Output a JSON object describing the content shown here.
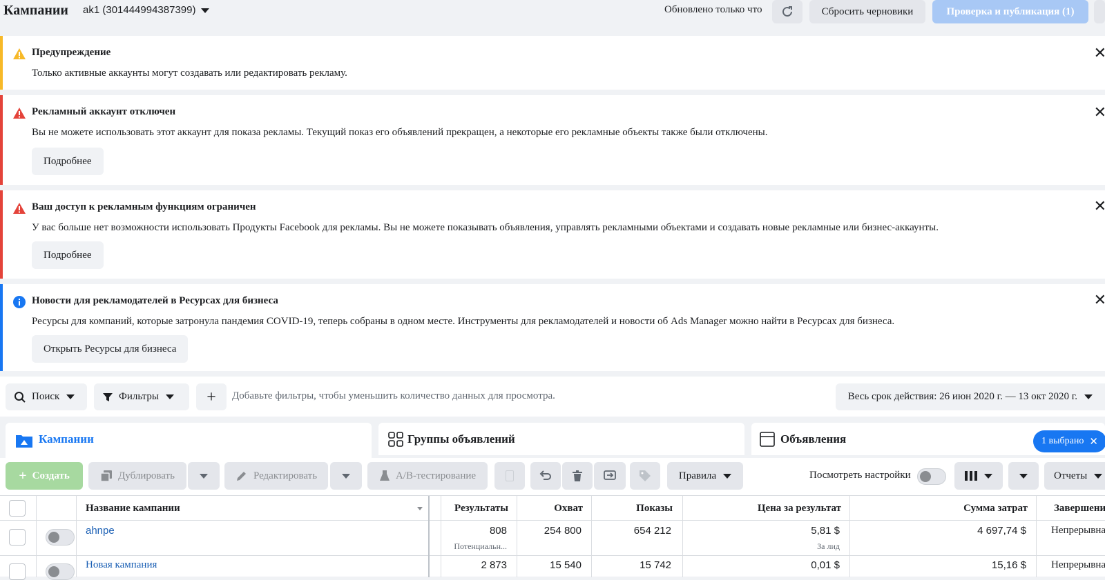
{
  "topbar": {
    "title": "Кампании",
    "account": "ak1 (301444994387399)",
    "updated": "Обновлено только что",
    "reset_drafts": "Сбросить черновики",
    "publish": "Проверка и публикация (1)"
  },
  "alerts": [
    {
      "title": "Предупреждение",
      "body": "Только активные аккаунты могут создавать или редактировать рекламу."
    },
    {
      "title": "Рекламный аккаунт отключен",
      "body": "Вы не можете использовать этот аккаунт для показа рекламы. Текущий показ его объявлений прекращен, а некоторые его рекламные объекты также были отключены.",
      "button": "Подробнее"
    },
    {
      "title": "Ваш доступ к рекламным функциям ограничен",
      "body": "У вас больше нет возможности использовать Продукты Facebook для рекламы. Вы не можете показывать объявления, управлять рекламными объектами и создавать новые рекламные или бизнес-аккаунты.",
      "button": "Подробнее"
    },
    {
      "title": "Новости для рекламодателей в Ресурсах для бизнеса",
      "body": "Ресурсы для компаний, которые затронула пандемия COVID-19, теперь собраны в одном месте. Инструменты для рекламодателей и новости об Ads Manager можно найти в Ресурсах для бизнеса.",
      "button": "Открыть Ресурсы для бизнеса"
    }
  ],
  "filterbar": {
    "search": "Поиск",
    "filters": "Фильтры",
    "hint": "Добавьте фильтры, чтобы уменьшить количество данных для просмотра.",
    "date": "Весь срок действия: 26 июн 2020 г. — 13 окт 2020 г."
  },
  "tabs": {
    "campaigns": "Кампании",
    "adsets": "Группы объявлений",
    "ads": "Объявления",
    "selected": "1 выбрано"
  },
  "toolbar": {
    "create": "Создать",
    "duplicate": "Дублировать",
    "edit": "Редактировать",
    "ab_test": "A/B-тестирование",
    "rules": "Правила",
    "view_settings": "Посмотреть настройки",
    "reports": "Отчеты"
  },
  "table": {
    "headers": {
      "name": "Название кампании",
      "results": "Результаты",
      "reach": "Охват",
      "impressions": "Показы",
      "cost_per_result": "Цена за результат",
      "amount_spent": "Сумма затрат",
      "ends": "Завершени"
    },
    "rows": [
      {
        "name": "ahnpe",
        "results": "808",
        "results_sub": "Потенциальн...",
        "reach": "254 800",
        "impressions": "654 212",
        "cost": "5,81 $",
        "cost_sub": "За лид",
        "spent": "4 697,74 $",
        "ends": "Непрерывна"
      },
      {
        "name": "Новая кампания",
        "results": "2 873",
        "reach": "15 540",
        "impressions": "15 742",
        "cost": "0,01 $",
        "spent": "15,16 $",
        "ends": "Непрерывна"
      }
    ]
  },
  "colors": {
    "warning": "#f7b928",
    "error": "#e4433a",
    "info": "#1877f2",
    "link": "#1a5fb4"
  }
}
